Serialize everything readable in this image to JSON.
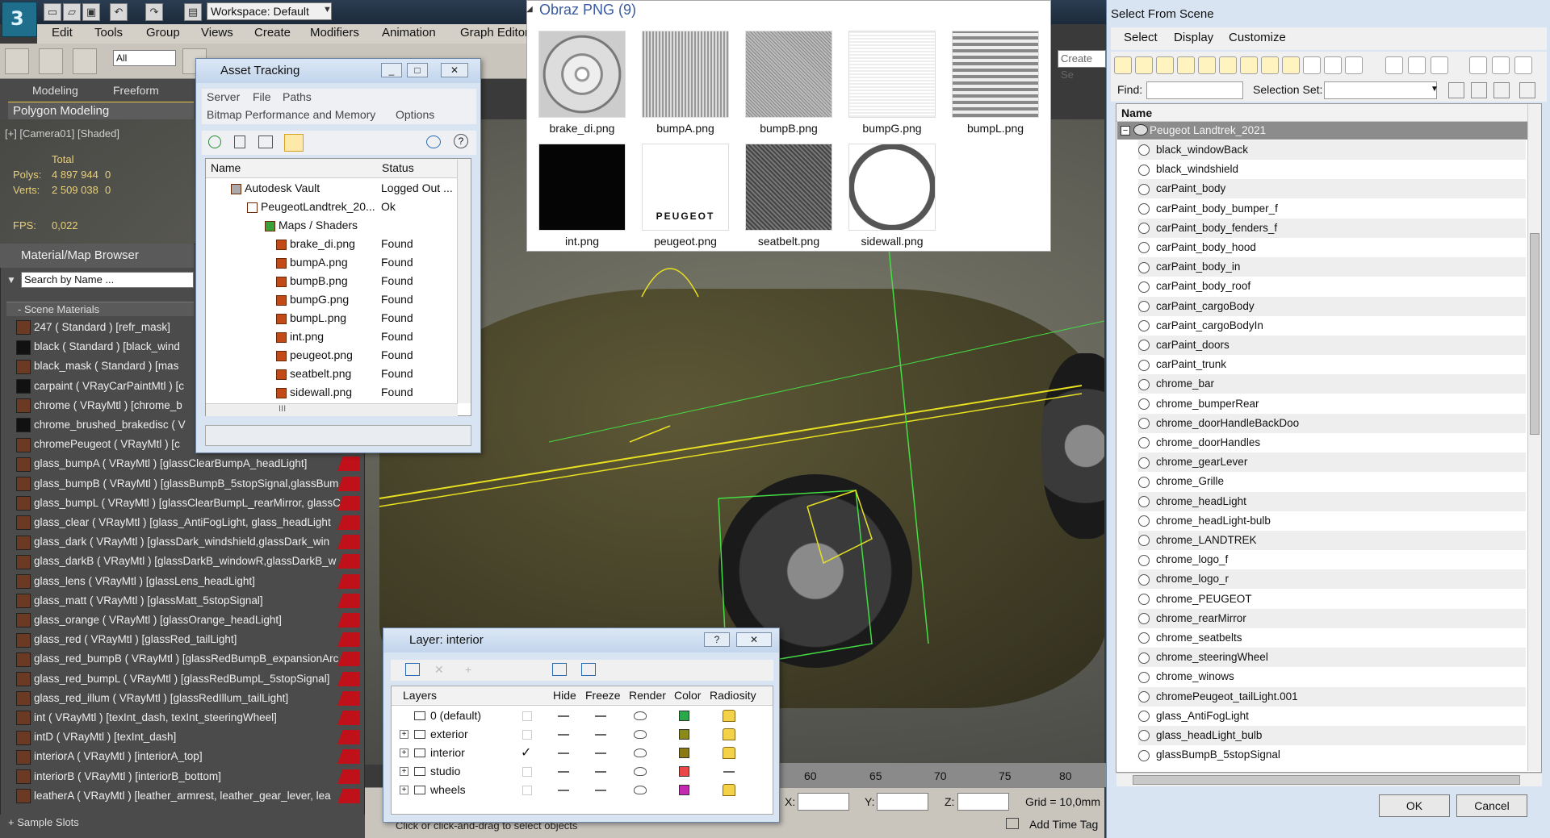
{
  "app": {
    "workspace": "Workspace: Default",
    "menus": [
      "Edit",
      "Tools",
      "Group",
      "Views",
      "Create",
      "Modifiers",
      "Animation",
      "Graph Editors"
    ],
    "selection_filter": "All",
    "create_sel": "Create Se",
    "ribbon_tabs": [
      "Modeling",
      "Freeform"
    ],
    "ribbon_panel": "Polygon Modeling"
  },
  "viewport": {
    "label": "[+] [Camera01] [Shaded]",
    "total_label": "Total",
    "polys_label": "Polys:",
    "polys_value": "4 897 944",
    "polys_sel": "0",
    "verts_label": "Verts:",
    "verts_value": "2 509 038",
    "verts_sel": "0",
    "fps_label": "FPS:",
    "fps_value": "0,022",
    "ruler_ticks": [
      "60",
      "65",
      "70",
      "75",
      "80"
    ],
    "x_label": "X:",
    "y_label": "Y:",
    "z_label": "Z:",
    "grid": "Grid = 10,0mm",
    "add_time_tag": "Add Time Tag",
    "prompt": "Click or click-and-drag to select objects"
  },
  "material_browser": {
    "title": "Material/Map Browser",
    "search_placeholder": "Search by Name ...",
    "section": "- Scene Materials",
    "items": [
      "247  ( Standard ) [refr_mask]",
      "black  ( Standard ) [black_wind",
      "black_mask  ( Standard ) [mas",
      "carpaint  ( VRayCarPaintMtl ) [c",
      "chrome  ( VRayMtl ) [chrome_b",
      "chrome_brushed_brakedisc  ( V",
      "chromePeugeot  ( VRayMtl ) [c",
      "glass_bumpA  ( VRayMtl ) [glassClearBumpA_headLight]",
      "glass_bumpB  ( VRayMtl ) [glassBumpB_5stopSignal,glassBum",
      "glass_bumpL  ( VRayMtl ) [glassClearBumpL_rearMirror, glassC",
      "glass_clear  ( VRayMtl ) [glass_AntiFogLight, glass_headLight",
      "glass_dark  ( VRayMtl ) [glassDark_windshield,glassDark_win",
      "glass_darkB  ( VRayMtl ) [glassDarkB_windowR,glassDarkB_w",
      "glass_lens  ( VRayMtl ) [glassLens_headLight]",
      "glass_matt  ( VRayMtl ) [glassMatt_5stopSignal]",
      "glass_orange  ( VRayMtl ) [glassOrange_headLight]",
      "glass_red  ( VRayMtl ) [glassRed_tailLight]",
      "glass_red_bumpB  ( VRayMtl ) [glassRedBumpB_expansionArc",
      "glass_red_bumpL  ( VRayMtl ) [glassRedBumpL_5stopSignal]",
      "glass_red_illum  ( VRayMtl ) [glassRedIllum_tailLight]",
      "int  ( VRayMtl ) [texInt_dash, texInt_steeringWheel]",
      "intD  ( VRayMtl ) [texInt_dash]",
      "interiorA  ( VRayMtl ) [interiorA_top]",
      "interiorB  ( VRayMtl ) [interiorB_bottom]",
      "leatherA  ( VRayMtl ) [leather_armrest, leather_gear_lever, lea"
    ],
    "bottom": "+ Sample Slots"
  },
  "asset_tracking": {
    "title": "Asset Tracking",
    "menu_row1": [
      "Server",
      "File",
      "Paths"
    ],
    "menu_row2": [
      "Bitmap Performance and Memory",
      "Options"
    ],
    "col_name": "Name",
    "col_status": "Status",
    "rows": [
      {
        "name": "Autodesk Vault",
        "status": "Logged Out ..."
      },
      {
        "name": "PeugeotLandtrek_20...",
        "status": "Ok"
      },
      {
        "name": "Maps / Shaders",
        "status": ""
      },
      {
        "name": "brake_di.png",
        "status": "Found"
      },
      {
        "name": "bumpA.png",
        "status": "Found"
      },
      {
        "name": "bumpB.png",
        "status": "Found"
      },
      {
        "name": "bumpG.png",
        "status": "Found"
      },
      {
        "name": "bumpL.png",
        "status": "Found"
      },
      {
        "name": "int.png",
        "status": "Found"
      },
      {
        "name": "peugeot.png",
        "status": "Found"
      },
      {
        "name": "seatbelt.png",
        "status": "Found"
      },
      {
        "name": "sidewall.png",
        "status": "Found"
      }
    ],
    "scroll_mark": "III"
  },
  "png_viewer": {
    "title": "Obraz PNG (9)",
    "thumbs": [
      "brake_di.png",
      "bumpA.png",
      "bumpB.png",
      "bumpG.png",
      "bumpL.png",
      "int.png",
      "peugeot.png",
      "seatbelt.png",
      "sidewall.png"
    ],
    "peugeot_text": "PEUGEOT"
  },
  "layer_dialog": {
    "title": "Layer: interior",
    "help": "?",
    "close": "✕",
    "cols": [
      "Layers",
      "Hide",
      "Freeze",
      "Render",
      "Color",
      "Radiosity"
    ],
    "rows": [
      {
        "name": "0 (default)",
        "color": "#2aa84a",
        "current": false
      },
      {
        "name": "exterior",
        "color": "#8a8a1a",
        "current": false
      },
      {
        "name": "interior",
        "color": "#8a7a14",
        "current": true
      },
      {
        "name": "studio",
        "color": "#e84848",
        "current": false
      },
      {
        "name": "wheels",
        "color": "#c42ab0",
        "current": false
      }
    ],
    "check": "✓"
  },
  "select_from_scene": {
    "title": "Select From Scene",
    "menus": [
      "Select",
      "Display",
      "Customize"
    ],
    "find_label": "Find:",
    "selset_label": "Selection Set:",
    "col_name": "Name",
    "root": "Peugeot Landtrek_2021",
    "objects": [
      "black_windowBack",
      "black_windshield",
      "carPaint_body",
      "carPaint_body_bumper_f",
      "carPaint_body_fenders_f",
      "carPaint_body_hood",
      "carPaint_body_in",
      "carPaint_body_roof",
      "carPaint_cargoBody",
      "carPaint_cargoBodyIn",
      "carPaint_doors",
      "carPaint_trunk",
      "chrome_bar",
      "chrome_bumperRear",
      "chrome_doorHandleBackDoo",
      "chrome_doorHandles",
      "chrome_gearLever",
      "chrome_Grille",
      "chrome_headLight",
      "chrome_headLight-bulb",
      "chrome_LANDTREK",
      "chrome_logo_f",
      "chrome_logo_r",
      "chrome_PEUGEOT",
      "chrome_rearMirror",
      "chrome_seatbelts",
      "chrome_steeringWheel",
      "chrome_winows",
      "chromePeugeot_tailLight.001",
      "glass_AntiFogLight",
      "glass_headLight_bulb",
      "glassBumpB_5stopSignal"
    ],
    "ok": "OK",
    "cancel": "Cancel"
  }
}
